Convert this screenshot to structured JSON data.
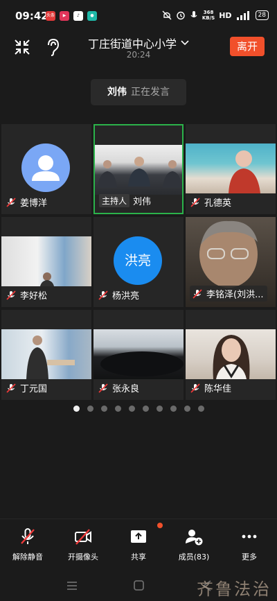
{
  "status_bar": {
    "time": "09:42",
    "speed": "368",
    "speed_unit": "KB/S",
    "network": "HD",
    "battery": "28",
    "app_icon_text": "头条"
  },
  "header": {
    "title": "丁庄街道中心小学",
    "time": "20:24",
    "leave_label": "离开"
  },
  "speaking": {
    "name": "刘伟",
    "status": "正在发言"
  },
  "participants": [
    {
      "name": "姜博洋",
      "avatar": "generic"
    },
    {
      "name": "刘伟",
      "host_tag": "主持人",
      "active": true
    },
    {
      "name": "孔德英"
    },
    {
      "name": "李好松"
    },
    {
      "name": "杨洪亮",
      "avatar_text": "洪亮"
    },
    {
      "name": "李铭泽(刘洪..."
    },
    {
      "name": "丁元国"
    },
    {
      "name": "张永良"
    },
    {
      "name": "陈华佳"
    }
  ],
  "pagination": {
    "total": 10,
    "current": 1
  },
  "toolbar": {
    "unmute": "解除静音",
    "camera": "开摄像头",
    "share": "共享",
    "members": "成员(83)",
    "more": "更多"
  },
  "watermark": "齐鲁法治",
  "colors": {
    "accent": "#f1502b",
    "active_border": "#2bb34a",
    "avatar_blue": "#1a8cf0"
  }
}
